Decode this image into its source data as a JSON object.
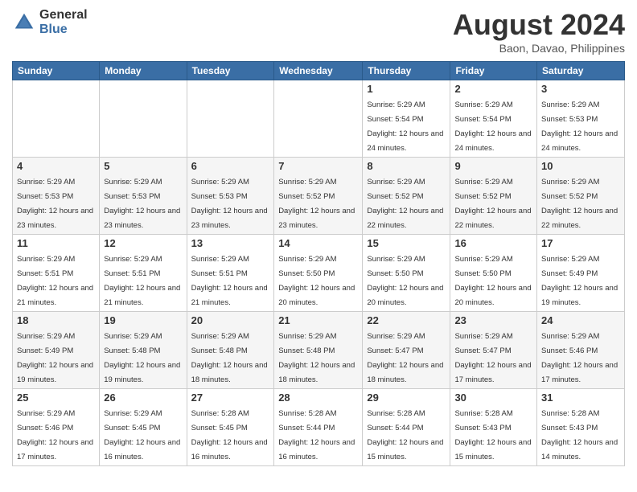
{
  "logo": {
    "general": "General",
    "blue": "Blue"
  },
  "header": {
    "month_year": "August 2024",
    "location": "Baon, Davao, Philippines"
  },
  "days_of_week": [
    "Sunday",
    "Monday",
    "Tuesday",
    "Wednesday",
    "Thursday",
    "Friday",
    "Saturday"
  ],
  "weeks": [
    [
      {
        "day": "",
        "sunrise": "",
        "sunset": "",
        "daylight": ""
      },
      {
        "day": "",
        "sunrise": "",
        "sunset": "",
        "daylight": ""
      },
      {
        "day": "",
        "sunrise": "",
        "sunset": "",
        "daylight": ""
      },
      {
        "day": "",
        "sunrise": "",
        "sunset": "",
        "daylight": ""
      },
      {
        "day": "1",
        "sunrise": "Sunrise: 5:29 AM",
        "sunset": "Sunset: 5:54 PM",
        "daylight": "Daylight: 12 hours and 24 minutes."
      },
      {
        "day": "2",
        "sunrise": "Sunrise: 5:29 AM",
        "sunset": "Sunset: 5:54 PM",
        "daylight": "Daylight: 12 hours and 24 minutes."
      },
      {
        "day": "3",
        "sunrise": "Sunrise: 5:29 AM",
        "sunset": "Sunset: 5:53 PM",
        "daylight": "Daylight: 12 hours and 24 minutes."
      }
    ],
    [
      {
        "day": "4",
        "sunrise": "Sunrise: 5:29 AM",
        "sunset": "Sunset: 5:53 PM",
        "daylight": "Daylight: 12 hours and 23 minutes."
      },
      {
        "day": "5",
        "sunrise": "Sunrise: 5:29 AM",
        "sunset": "Sunset: 5:53 PM",
        "daylight": "Daylight: 12 hours and 23 minutes."
      },
      {
        "day": "6",
        "sunrise": "Sunrise: 5:29 AM",
        "sunset": "Sunset: 5:53 PM",
        "daylight": "Daylight: 12 hours and 23 minutes."
      },
      {
        "day": "7",
        "sunrise": "Sunrise: 5:29 AM",
        "sunset": "Sunset: 5:52 PM",
        "daylight": "Daylight: 12 hours and 23 minutes."
      },
      {
        "day": "8",
        "sunrise": "Sunrise: 5:29 AM",
        "sunset": "Sunset: 5:52 PM",
        "daylight": "Daylight: 12 hours and 22 minutes."
      },
      {
        "day": "9",
        "sunrise": "Sunrise: 5:29 AM",
        "sunset": "Sunset: 5:52 PM",
        "daylight": "Daylight: 12 hours and 22 minutes."
      },
      {
        "day": "10",
        "sunrise": "Sunrise: 5:29 AM",
        "sunset": "Sunset: 5:52 PM",
        "daylight": "Daylight: 12 hours and 22 minutes."
      }
    ],
    [
      {
        "day": "11",
        "sunrise": "Sunrise: 5:29 AM",
        "sunset": "Sunset: 5:51 PM",
        "daylight": "Daylight: 12 hours and 21 minutes."
      },
      {
        "day": "12",
        "sunrise": "Sunrise: 5:29 AM",
        "sunset": "Sunset: 5:51 PM",
        "daylight": "Daylight: 12 hours and 21 minutes."
      },
      {
        "day": "13",
        "sunrise": "Sunrise: 5:29 AM",
        "sunset": "Sunset: 5:51 PM",
        "daylight": "Daylight: 12 hours and 21 minutes."
      },
      {
        "day": "14",
        "sunrise": "Sunrise: 5:29 AM",
        "sunset": "Sunset: 5:50 PM",
        "daylight": "Daylight: 12 hours and 20 minutes."
      },
      {
        "day": "15",
        "sunrise": "Sunrise: 5:29 AM",
        "sunset": "Sunset: 5:50 PM",
        "daylight": "Daylight: 12 hours and 20 minutes."
      },
      {
        "day": "16",
        "sunrise": "Sunrise: 5:29 AM",
        "sunset": "Sunset: 5:50 PM",
        "daylight": "Daylight: 12 hours and 20 minutes."
      },
      {
        "day": "17",
        "sunrise": "Sunrise: 5:29 AM",
        "sunset": "Sunset: 5:49 PM",
        "daylight": "Daylight: 12 hours and 19 minutes."
      }
    ],
    [
      {
        "day": "18",
        "sunrise": "Sunrise: 5:29 AM",
        "sunset": "Sunset: 5:49 PM",
        "daylight": "Daylight: 12 hours and 19 minutes."
      },
      {
        "day": "19",
        "sunrise": "Sunrise: 5:29 AM",
        "sunset": "Sunset: 5:48 PM",
        "daylight": "Daylight: 12 hours and 19 minutes."
      },
      {
        "day": "20",
        "sunrise": "Sunrise: 5:29 AM",
        "sunset": "Sunset: 5:48 PM",
        "daylight": "Daylight: 12 hours and 18 minutes."
      },
      {
        "day": "21",
        "sunrise": "Sunrise: 5:29 AM",
        "sunset": "Sunset: 5:48 PM",
        "daylight": "Daylight: 12 hours and 18 minutes."
      },
      {
        "day": "22",
        "sunrise": "Sunrise: 5:29 AM",
        "sunset": "Sunset: 5:47 PM",
        "daylight": "Daylight: 12 hours and 18 minutes."
      },
      {
        "day": "23",
        "sunrise": "Sunrise: 5:29 AM",
        "sunset": "Sunset: 5:47 PM",
        "daylight": "Daylight: 12 hours and 17 minutes."
      },
      {
        "day": "24",
        "sunrise": "Sunrise: 5:29 AM",
        "sunset": "Sunset: 5:46 PM",
        "daylight": "Daylight: 12 hours and 17 minutes."
      }
    ],
    [
      {
        "day": "25",
        "sunrise": "Sunrise: 5:29 AM",
        "sunset": "Sunset: 5:46 PM",
        "daylight": "Daylight: 12 hours and 17 minutes."
      },
      {
        "day": "26",
        "sunrise": "Sunrise: 5:29 AM",
        "sunset": "Sunset: 5:45 PM",
        "daylight": "Daylight: 12 hours and 16 minutes."
      },
      {
        "day": "27",
        "sunrise": "Sunrise: 5:28 AM",
        "sunset": "Sunset: 5:45 PM",
        "daylight": "Daylight: 12 hours and 16 minutes."
      },
      {
        "day": "28",
        "sunrise": "Sunrise: 5:28 AM",
        "sunset": "Sunset: 5:44 PM",
        "daylight": "Daylight: 12 hours and 16 minutes."
      },
      {
        "day": "29",
        "sunrise": "Sunrise: 5:28 AM",
        "sunset": "Sunset: 5:44 PM",
        "daylight": "Daylight: 12 hours and 15 minutes."
      },
      {
        "day": "30",
        "sunrise": "Sunrise: 5:28 AM",
        "sunset": "Sunset: 5:43 PM",
        "daylight": "Daylight: 12 hours and 15 minutes."
      },
      {
        "day": "31",
        "sunrise": "Sunrise: 5:28 AM",
        "sunset": "Sunset: 5:43 PM",
        "daylight": "Daylight: 12 hours and 14 minutes."
      }
    ]
  ]
}
